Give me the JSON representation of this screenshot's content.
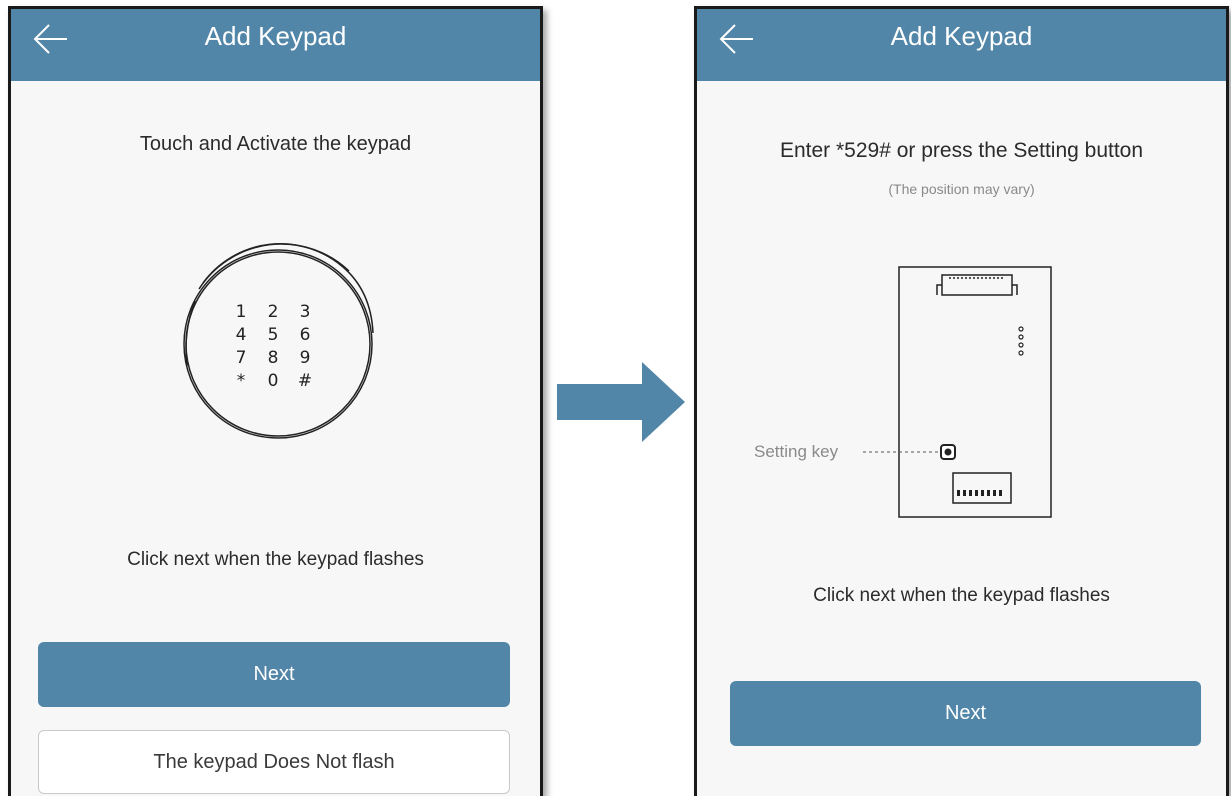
{
  "colors": {
    "header": "#5286a8",
    "button": "#5286a8",
    "arrow": "#5286a8"
  },
  "left_screen": {
    "header": {
      "title": "Add Keypad",
      "back_icon": "arrow-left-icon"
    },
    "instruction": "Touch and Activate the keypad",
    "keypad": {
      "rows": [
        [
          "1",
          "2",
          "3"
        ],
        [
          "4",
          "5",
          "6"
        ],
        [
          "7",
          "8",
          "9"
        ],
        [
          "*",
          "0",
          "#"
        ]
      ]
    },
    "hint": "Click next when the keypad flashes",
    "next_button": "Next",
    "not_flash_button": "The keypad Does Not flash"
  },
  "right_screen": {
    "header": {
      "title": "Add Keypad",
      "back_icon": "arrow-left-icon"
    },
    "instruction": "Enter *529# or press the Setting button",
    "note": "(The position may vary)",
    "setting_key_label": "Setting key",
    "hint": "Click next when the keypad flashes",
    "next_button": "Next"
  }
}
